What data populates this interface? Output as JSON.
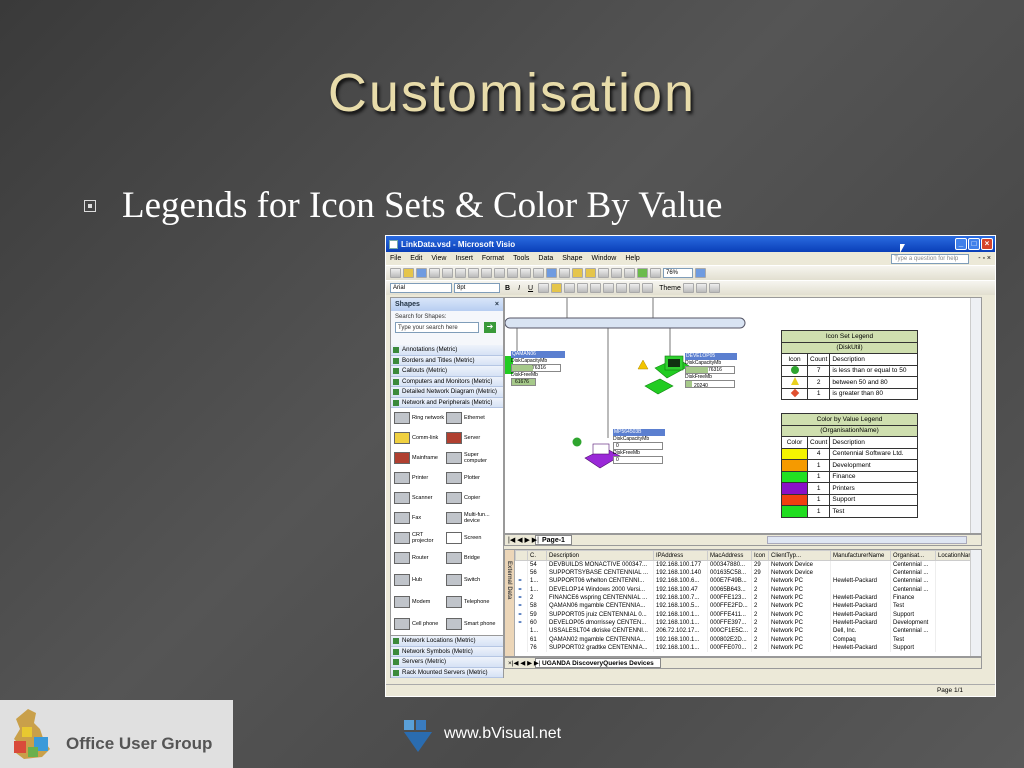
{
  "slide": {
    "title": "Customisation",
    "bullet": "Legends for Icon Sets & Color By Value",
    "footer_org": "Office User Group",
    "footer_url": "www.bVisual.net"
  },
  "window": {
    "title": "LinkData.vsd - Microsoft Visio",
    "menu": [
      "File",
      "Edit",
      "View",
      "Insert",
      "Format",
      "Tools",
      "Data",
      "Shape",
      "Window",
      "Help"
    ],
    "help_placeholder": "Type a question for help",
    "zoom": "76%",
    "font": "Arial",
    "font_size": "8pt",
    "theme_label": "Theme"
  },
  "shapes_panel": {
    "title": "Shapes",
    "search_label": "Search for Shapes:",
    "search_placeholder": "Type your search here",
    "stencils_top": [
      "Annotations (Metric)",
      "Borders and Titles (Metric)",
      "Callouts (Metric)",
      "Computers and Monitors (Metric)",
      "Detailed Network Diagram (Metric)",
      "Network and Peripherals (Metric)"
    ],
    "items": [
      "Ring network",
      "Ethernet",
      "Comm-link",
      "Server",
      "Mainframe",
      "Super computer",
      "Printer",
      "Plotter",
      "Scanner",
      "Copier",
      "Fax",
      "Multi-fun... device",
      "CRT projector",
      "Screen",
      "Router",
      "Bridge",
      "Hub",
      "Switch",
      "Modem",
      "Telephone",
      "Cell phone",
      "Smart phone"
    ],
    "stencils_bottom": [
      "Network Locations (Metric)",
      "Network Symbols (Metric)",
      "Servers (Metric)",
      "Rack Mounted Servers (Metric)"
    ]
  },
  "drawing": {
    "nodes": [
      {
        "name": "QAMAN06",
        "l1": "DiskCapacityMb",
        "v1": "76316",
        "l2": "DiskFreeMb",
        "v2": "61676"
      },
      {
        "name": "DEVELOP05",
        "l1": "DiskCapacityMb",
        "v1": "76316",
        "l2": "DiskFreeMb",
        "v2": "20240"
      },
      {
        "name": "MP564503B",
        "l1": "DiskCapacityMb",
        "v1": "0",
        "l2": "DiskFreeMb",
        "v2": "0"
      }
    ],
    "icon_legend": {
      "title": "Icon Set Legend",
      "subtitle": "(DiskUtil)",
      "headers": [
        "Icon",
        "Count",
        "Description"
      ],
      "rows": [
        {
          "count": "7",
          "desc": "is less than or equal to 50",
          "color": "#2fa52f"
        },
        {
          "count": "2",
          "desc": "between 50 and 80",
          "color": "#e8d020"
        },
        {
          "count": "1",
          "desc": "is greater than 80",
          "color": "#e05030"
        }
      ]
    },
    "color_legend": {
      "title": "Color by Value Legend",
      "subtitle": "(OrganisationName)",
      "headers": [
        "Color",
        "Count",
        "Description"
      ],
      "rows": [
        {
          "count": "4",
          "desc": "Centennial Software Ltd.",
          "color": "#f5f500"
        },
        {
          "count": "1",
          "desc": "Development",
          "color": "#f59a00"
        },
        {
          "count": "1",
          "desc": "Finance",
          "color": "#22e022"
        },
        {
          "count": "1",
          "desc": "Printers",
          "color": "#8a10c8"
        },
        {
          "count": "1",
          "desc": "Support",
          "color": "#f04010"
        },
        {
          "count": "1",
          "desc": "Test",
          "color": "#20dd20"
        }
      ]
    },
    "page_tab": "Page-1"
  },
  "external_data": {
    "side_label": "External Data",
    "headers": [
      "C.",
      "Description",
      "IPAddress",
      "MacAddress",
      "Icon",
      "ClientTyp...",
      "ManufacturerName",
      "Organisat...",
      "LocationNan"
    ],
    "rows": [
      [
        "54",
        "DEVBUILDS MONACTIVE 000347...",
        "192.168.100.177",
        "000347880...",
        "29",
        "Network Device",
        "",
        "Centennial ..."
      ],
      [
        "56",
        "SUPPORTSYBASE CENTENNIAL ...",
        "192.168.100.140",
        "001635C58...",
        "29",
        "Network Device",
        "",
        "Centennial ..."
      ],
      [
        "1...",
        "SUPPORT06 whelton CENTENNI...",
        "192.168.100.6...",
        "000E7F49B...",
        "2",
        "Network PC",
        "Hewlett-Packard",
        "Centennial ..."
      ],
      [
        "1...",
        "DEVELOP14 Windows 2000 Versi...",
        "192.168.100.47",
        "00065B643...",
        "2",
        "Network PC",
        "",
        "Centennial ..."
      ],
      [
        "2",
        "FINANCE6 wspring CENTENNIAL ...",
        "192.168.100.7...",
        "000FFE123...",
        "2",
        "Network PC",
        "Hewlett-Packard",
        "Finance"
      ],
      [
        "58",
        "QAMAN06 mgamble CENTENNIA...",
        "192.168.100.5...",
        "000FFE2FD...",
        "2",
        "Network PC",
        "Hewlett-Packard",
        "Test"
      ],
      [
        "59",
        "SUPPORT05 jruiz CENTENNIAL 0...",
        "192.168.100.1...",
        "000FFE411...",
        "2",
        "Network PC",
        "Hewlett-Packard",
        "Support"
      ],
      [
        "60",
        "DEVELOP05 dmorrissey CENTEN...",
        "192.168.100.1...",
        "000FFE397...",
        "2",
        "Network PC",
        "Hewlett-Packard",
        "Development"
      ],
      [
        "1...",
        "USSALESLT04 dkriske CENTENNI...",
        "206.72.102.17...",
        "000CF1E5C...",
        "2",
        "Network PC",
        "Dell, Inc.",
        "Centennial ..."
      ],
      [
        "61",
        "QAMAN02 mgamble CENTENNIA...",
        "192.168.100.1...",
        "000802E2D...",
        "2",
        "Network PC",
        "Compaq",
        "Test"
      ],
      [
        "76",
        "SUPPORT02 gradtke CENTENNIA...",
        "192.168.100.1...",
        "000FFE070...",
        "2",
        "Network PC",
        "Hewlett-Packard",
        "Support"
      ]
    ],
    "tab": "UGANDA DiscoveryQueries Devices"
  },
  "status": {
    "page": "Page 1/1"
  }
}
